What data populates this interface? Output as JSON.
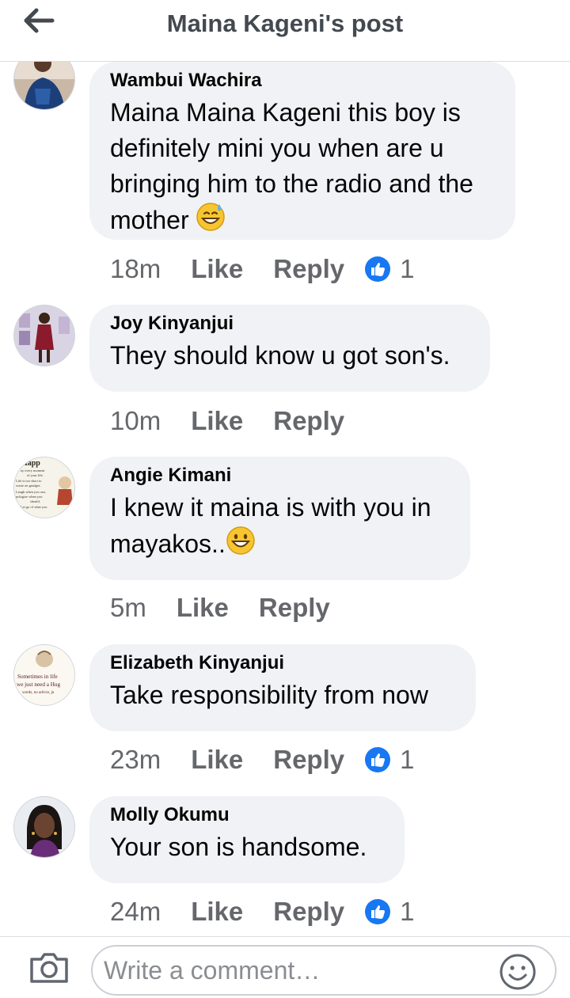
{
  "header": {
    "title": "Maina Kageni's post",
    "back_icon": "arrow-left-icon"
  },
  "comments": [
    {
      "author": "Wambui Wachira",
      "text": "Maina Maina Kageni this boy is definitely mini you when are u bringing him to the radio and the mother",
      "emoji": "grinning-sweat-emoji",
      "time": "18m",
      "like_label": "Like",
      "reply_label": "Reply",
      "reaction_icon": "thumbs-up-icon",
      "reaction_count": "1"
    },
    {
      "author": "Joy Kinyanjui",
      "text": "They should know u got son's.",
      "time": "10m",
      "like_label": "Like",
      "reply_label": "Reply"
    },
    {
      "author": "Angie Kimani",
      "text": "I knew it maina is with you in mayakos..",
      "emoji": "grinning-emoji",
      "time": "5m",
      "like_label": "Like",
      "reply_label": "Reply",
      "avatar_text": [
        "e Happ",
        "ay every moment",
        "of your life.",
        "Life is too short to",
        "waste on grudges.",
        "Laugh when you can,",
        "pologize when you",
        "should,",
        "Let go of what you"
      ]
    },
    {
      "author": "Elizabeth Kinyanjui",
      "text": "Take responsibility from now",
      "time": "23m",
      "like_label": "Like",
      "reply_label": "Reply",
      "reaction_icon": "thumbs-up-icon",
      "reaction_count": "1",
      "avatar_text": [
        "Sometimes in life",
        "we just need a Hug",
        "words, no advice, ju"
      ]
    },
    {
      "author": "Molly Okumu",
      "text": "Your son is handsome.",
      "time": "24m",
      "like_label": "Like",
      "reply_label": "Reply",
      "reaction_icon": "thumbs-up-icon",
      "reaction_count": "1"
    }
  ],
  "composer": {
    "placeholder": "Write a comment…",
    "camera_icon": "camera-icon",
    "emoji_icon": "smiley-icon"
  },
  "colors": {
    "bubble": "#f0f2f5",
    "meta_text": "#65676b",
    "like_blue": "#1877f2",
    "header_title": "#444950"
  }
}
